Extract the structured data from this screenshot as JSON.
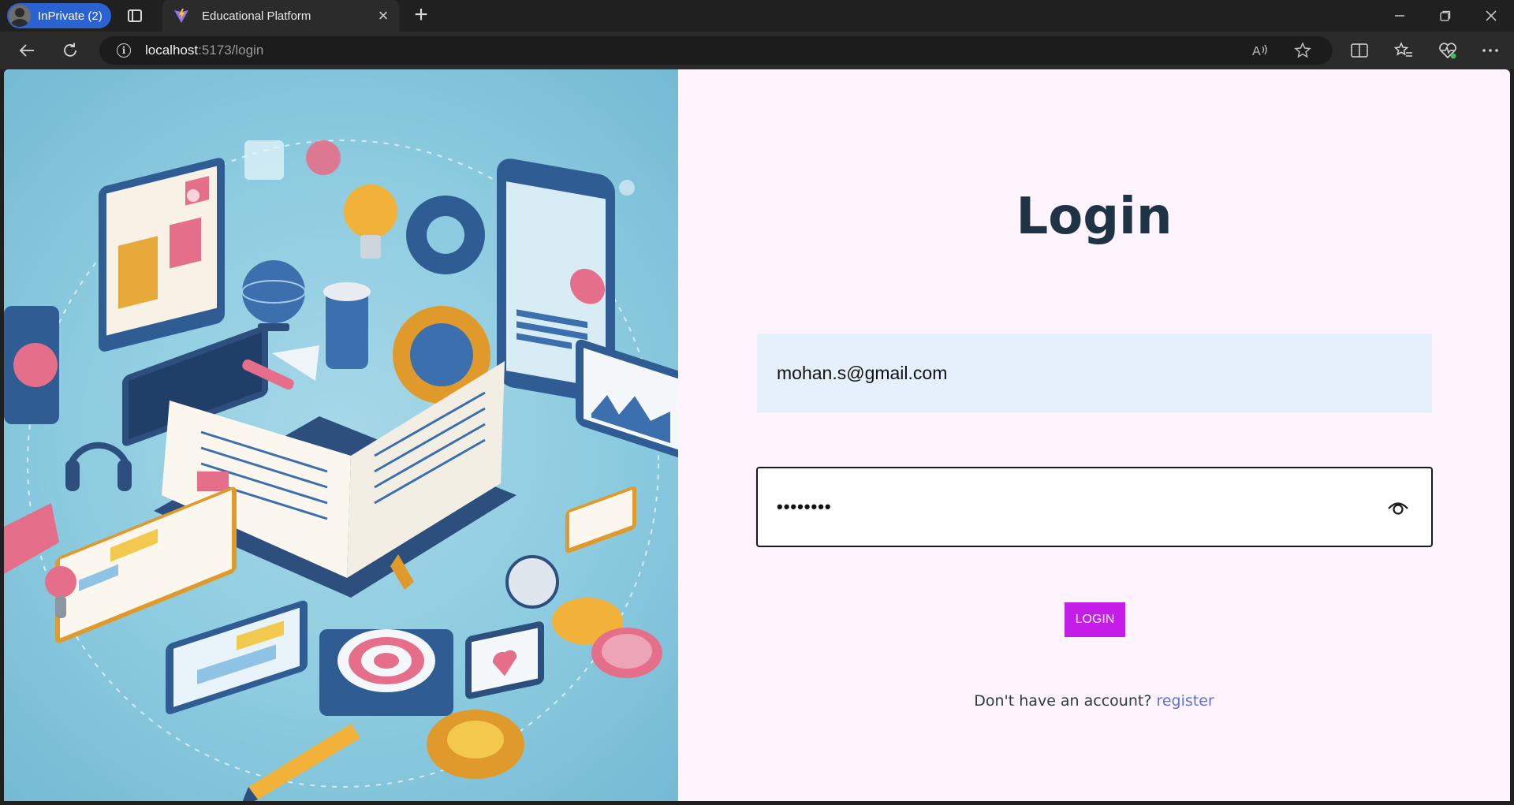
{
  "browser": {
    "profile_label": "InPrivate (2)",
    "tab_title": "Educational Platform",
    "url_host": "localhost",
    "url_path": ":5173/login",
    "icons": {
      "profile": "inprivate-avatar-icon",
      "tab_actions": "tab-actions-icon",
      "tab_close": "close-icon",
      "new_tab": "plus-icon",
      "back": "back-arrow-icon",
      "refresh": "refresh-icon",
      "site_info": "info-icon",
      "read_aloud": "read-aloud-icon",
      "favorite": "star-icon",
      "split_screen": "split-screen-icon",
      "favorites": "favorites-icon",
      "browser_essentials": "heart-pulse-icon",
      "more": "more-icon",
      "minimize": "minimize-icon",
      "restore": "restore-icon",
      "close_window": "close-window-icon"
    }
  },
  "login": {
    "title": "Login",
    "email_value": "mohan.s@gmail.com",
    "password_masked": "••••••••",
    "show_password_icon": "eye-icon",
    "button_label": "LOGIN",
    "no_account_text": "Don't have an account? ",
    "register_link": "register"
  },
  "colors": {
    "accent_button": "#c51de8",
    "link": "#5f6fe0",
    "title": "#1f3347",
    "email_bg": "#e6f0fd",
    "page_bg": "#fdf4fd",
    "hero_bg": "#8ccbe0"
  }
}
